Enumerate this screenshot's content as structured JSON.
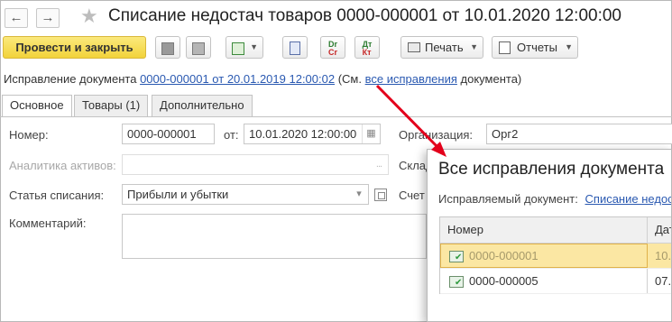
{
  "window": {
    "title": "Списание недостач товаров 0000-000001 от 10.01.2020 12:00:00",
    "back_icon": "←",
    "forward_icon": "→",
    "favorite_icon": "★"
  },
  "toolbar": {
    "post_close_label": "Провести и закрыть",
    "print_label": "Печать",
    "reports_label": "Отчеты",
    "dt_cr_label_top": "Dr",
    "dt_cr_label_bottom": "Cr",
    "dt_kt_label_top": "Дт",
    "dt_kt_label_bottom": "Кт",
    "dropdown_caret": "▼"
  },
  "correction": {
    "prefix": "Исправление документа",
    "doc_link": "0000-000001 от 20.01.2019 12:00:02",
    "middle": "(См.",
    "all_link": "все исправления",
    "suffix": "документа)"
  },
  "tabs": [
    {
      "label": "Основное",
      "active": true
    },
    {
      "label": "Товары (1)",
      "active": false
    },
    {
      "label": "Дополнительно",
      "active": false
    }
  ],
  "form": {
    "number_label": "Номер:",
    "number_value": "0000-000001",
    "date_label": "от:",
    "date_value": "10.01.2020 12:00:00",
    "org_label": "Организация:",
    "org_value": "Орг2",
    "analytics_label": "Аналитика активов:",
    "analytics_value": "",
    "warehouse_label_partial": "Склад",
    "article_label": "Статья списания:",
    "article_value": "Прибыли и убытки",
    "account_label_partial": "Счет",
    "comment_label": "Комментарий:",
    "comment_value": ""
  },
  "popup": {
    "title": "Все исправления документа",
    "sub_label": "Исправляемый документ:",
    "sub_link": "Списание недос",
    "columns": [
      "Номер",
      "Дат"
    ],
    "rows": [
      {
        "number": "0000-000001",
        "date": "10.",
        "selected": true
      },
      {
        "number": "0000-000005",
        "date": "07.",
        "selected": false
      }
    ]
  },
  "colors": {
    "accent_primary": "#f2d33a",
    "link": "#2a59b1",
    "selection": "#fbe7a3",
    "annotation_arrow": "#e3001b"
  }
}
